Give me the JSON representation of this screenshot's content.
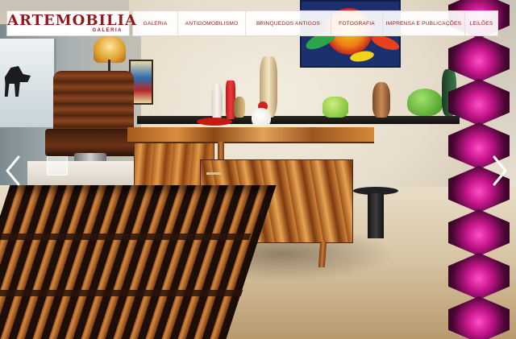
{
  "logo": {
    "title": "ARTEMOBILIA",
    "subtitle": "GALERIA"
  },
  "nav": {
    "items": [
      {
        "label": "GALERIA"
      },
      {
        "label": "ANTIGOMOBILISMO"
      },
      {
        "label": "BRINQUEDOS ANTIGOS"
      },
      {
        "label": "FOTOGRAFIA"
      },
      {
        "label": "IMPRENSA E PUBLICAÇÕES"
      },
      {
        "label": "LEILÕES"
      }
    ]
  },
  "slider": {
    "prev_icon": "chevron-left-icon",
    "next_icon": "chevron-right-icon"
  },
  "colors": {
    "brand": "#8d1b1b",
    "nav_bg": "#ffffff"
  }
}
